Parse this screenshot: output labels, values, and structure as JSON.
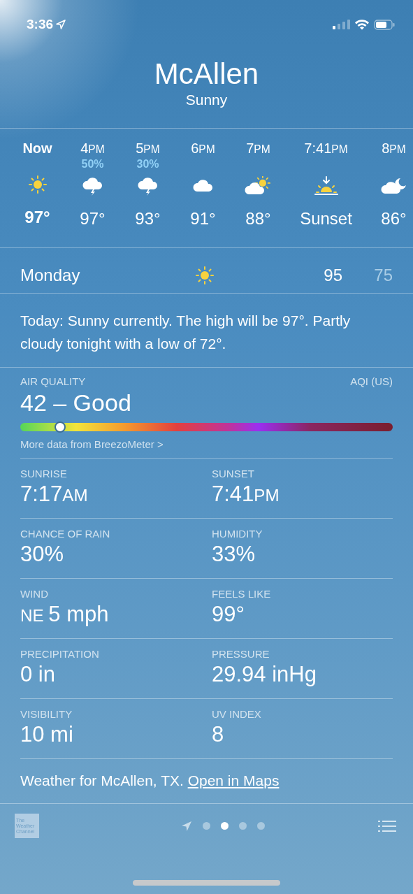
{
  "status_bar": {
    "time": "3:36"
  },
  "location": {
    "city": "McAllen",
    "condition": "Sunny"
  },
  "hourly": [
    {
      "time": "Now",
      "current": true,
      "kind": "sun",
      "temp": "97°"
    },
    {
      "time": "4",
      "meridiem": "PM",
      "current": false,
      "chance": "50%",
      "kind": "storm",
      "temp": "97°"
    },
    {
      "time": "5",
      "meridiem": "PM",
      "current": false,
      "chance": "30%",
      "kind": "storm",
      "temp": "93°"
    },
    {
      "time": "6",
      "meridiem": "PM",
      "current": false,
      "kind": "cloud",
      "temp": "91°"
    },
    {
      "time": "7",
      "meridiem": "PM",
      "current": false,
      "kind": "cloud-sun",
      "temp": "88°"
    },
    {
      "time": "7:41",
      "meridiem": "PM",
      "current": false,
      "kind": "sunset",
      "temp": "Sunset"
    },
    {
      "time": "8",
      "meridiem": "PM",
      "current": false,
      "kind": "cloud-moon",
      "temp": "86°"
    }
  ],
  "daily": [
    {
      "day": "Monday",
      "kind": "sun",
      "high": "95",
      "low": "75"
    }
  ],
  "summary": "Today: Sunny currently. The high will be 97°. Partly cloudy tonight with a low of 72°.",
  "air_quality": {
    "label": "AIR QUALITY",
    "scale": "AQI (US)",
    "value": "42 – Good",
    "level": 0.107,
    "source_link": "More data from BreezoMeter >"
  },
  "details": [
    {
      "label": "SUNRISE",
      "value": "7:17",
      "suffix": "AM"
    },
    {
      "label": "SUNSET",
      "value": "7:41",
      "suffix": "PM"
    },
    {
      "label": "CHANCE OF RAIN",
      "value": "30%"
    },
    {
      "label": "HUMIDITY",
      "value": "33%"
    },
    {
      "label": "WIND",
      "value": "5 mph",
      "prefix": "NE"
    },
    {
      "label": "FEELS LIKE",
      "value": "99°"
    },
    {
      "label": "PRECIPITATION",
      "value": "0 in"
    },
    {
      "label": "PRESSURE",
      "value": "29.94 inHg"
    },
    {
      "label": "VISIBILITY",
      "value": "10 mi"
    },
    {
      "label": "UV INDEX",
      "value": "8"
    }
  ],
  "footer": {
    "text": "Weather for McAllen, TX.",
    "link": "Open in Maps"
  },
  "bottom_bar": {
    "logo_text": [
      "The",
      "Weather",
      "Channel"
    ],
    "pages": [
      {
        "selected": false
      },
      {
        "selected": true
      },
      {
        "selected": false
      },
      {
        "selected": false
      }
    ]
  }
}
